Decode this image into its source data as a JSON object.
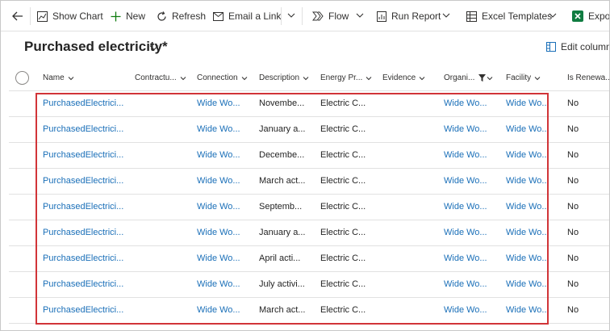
{
  "toolbar": {
    "show_chart": "Show Chart",
    "new": "New",
    "refresh": "Refresh",
    "email_link": "Email a Link",
    "flow": "Flow",
    "run_report": "Run Report",
    "excel_templates": "Excel Templates",
    "export": "Expo"
  },
  "view": {
    "title": "Purchased electricity*",
    "edit_columns": "Edit columns"
  },
  "grid": {
    "columns": [
      {
        "label": "Name"
      },
      {
        "label": "Contractu..."
      },
      {
        "label": "Connection"
      },
      {
        "label": "Description"
      },
      {
        "label": "Energy Pr..."
      },
      {
        "label": "Evidence"
      },
      {
        "label": "Organi..."
      },
      {
        "label": "Facility"
      },
      {
        "label": "Is Renewa..."
      }
    ],
    "rows": [
      {
        "name": "PurchasedElectrici...",
        "connection": "Wide Wo...",
        "description": "Novembe...",
        "energy": "Electric C...",
        "organization": "Wide Wo...",
        "facility": "Wide Wo...",
        "renewable": "No"
      },
      {
        "name": "PurchasedElectrici...",
        "connection": "Wide Wo...",
        "description": "January a...",
        "energy": "Electric C...",
        "organization": "Wide Wo...",
        "facility": "Wide Wo...",
        "renewable": "No"
      },
      {
        "name": "PurchasedElectrici...",
        "connection": "Wide Wo...",
        "description": "Decembe...",
        "energy": "Electric C...",
        "organization": "Wide Wo...",
        "facility": "Wide Wo...",
        "renewable": "No"
      },
      {
        "name": "PurchasedElectrici...",
        "connection": "Wide Wo...",
        "description": "March act...",
        "energy": "Electric C...",
        "organization": "Wide Wo...",
        "facility": "Wide Wo...",
        "renewable": "No"
      },
      {
        "name": "PurchasedElectrici...",
        "connection": "Wide Wo...",
        "description": "Septemb...",
        "energy": "Electric C...",
        "organization": "Wide Wo...",
        "facility": "Wide Wo...",
        "renewable": "No"
      },
      {
        "name": "PurchasedElectrici...",
        "connection": "Wide Wo...",
        "description": "January a...",
        "energy": "Electric C...",
        "organization": "Wide Wo...",
        "facility": "Wide Wo...",
        "renewable": "No"
      },
      {
        "name": "PurchasedElectrici...",
        "connection": "Wide Wo...",
        "description": "April acti...",
        "energy": "Electric C...",
        "organization": "Wide Wo...",
        "facility": "Wide Wo...",
        "renewable": "No"
      },
      {
        "name": "PurchasedElectrici...",
        "connection": "Wide Wo...",
        "description": "July activi...",
        "energy": "Electric C...",
        "organization": "Wide Wo...",
        "facility": "Wide Wo...",
        "renewable": "No"
      },
      {
        "name": "PurchasedElectrici...",
        "connection": "Wide Wo...",
        "description": "March act...",
        "energy": "Electric C...",
        "organization": "Wide Wo...",
        "facility": "Wide Wo...",
        "renewable": "No"
      }
    ]
  },
  "colors": {
    "link": "#1a6fb8",
    "highlight": "#d13438",
    "new_icon": "#107c10",
    "excel_icon": "#107c41"
  }
}
